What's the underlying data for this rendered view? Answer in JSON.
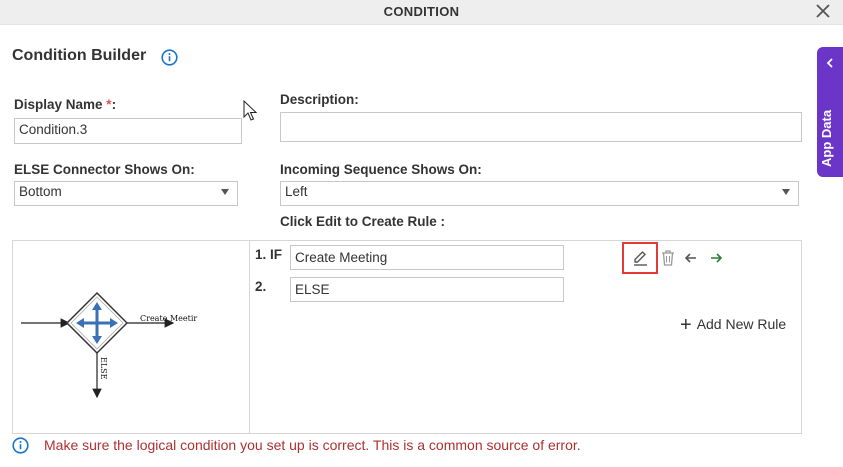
{
  "window": {
    "title": "CONDITION"
  },
  "builder": {
    "heading": "Condition Builder"
  },
  "form": {
    "display_name_label": "Display Name ",
    "display_name_required": "*",
    "display_name_colon": ":",
    "display_name_value": "Condition.3",
    "description_label": "Description:",
    "description_value": "",
    "else_connector_label": "ELSE Connector Shows On:",
    "else_connector_value": "Bottom",
    "incoming_sequence_label": "Incoming Sequence Shows On:",
    "incoming_sequence_value": "Left",
    "rule_instruction": "Click Edit to Create Rule :"
  },
  "diagram": {
    "branch_label": "Create Meetir",
    "else_label": "ELSE"
  },
  "rules": [
    {
      "num": "1. IF",
      "value": "Create Meeting"
    },
    {
      "num": "2.",
      "value": "ELSE"
    }
  ],
  "actions": {
    "add_rule": "Add New Rule"
  },
  "side_panel": {
    "label": "App Data"
  },
  "footer": {
    "message": "Make sure the logical condition you set up is correct. This is a common source of error."
  },
  "colors": {
    "accent": "#1a73c8",
    "side_panel": "#6b35c8",
    "error_text": "#b03030",
    "highlight": "#e53935"
  }
}
